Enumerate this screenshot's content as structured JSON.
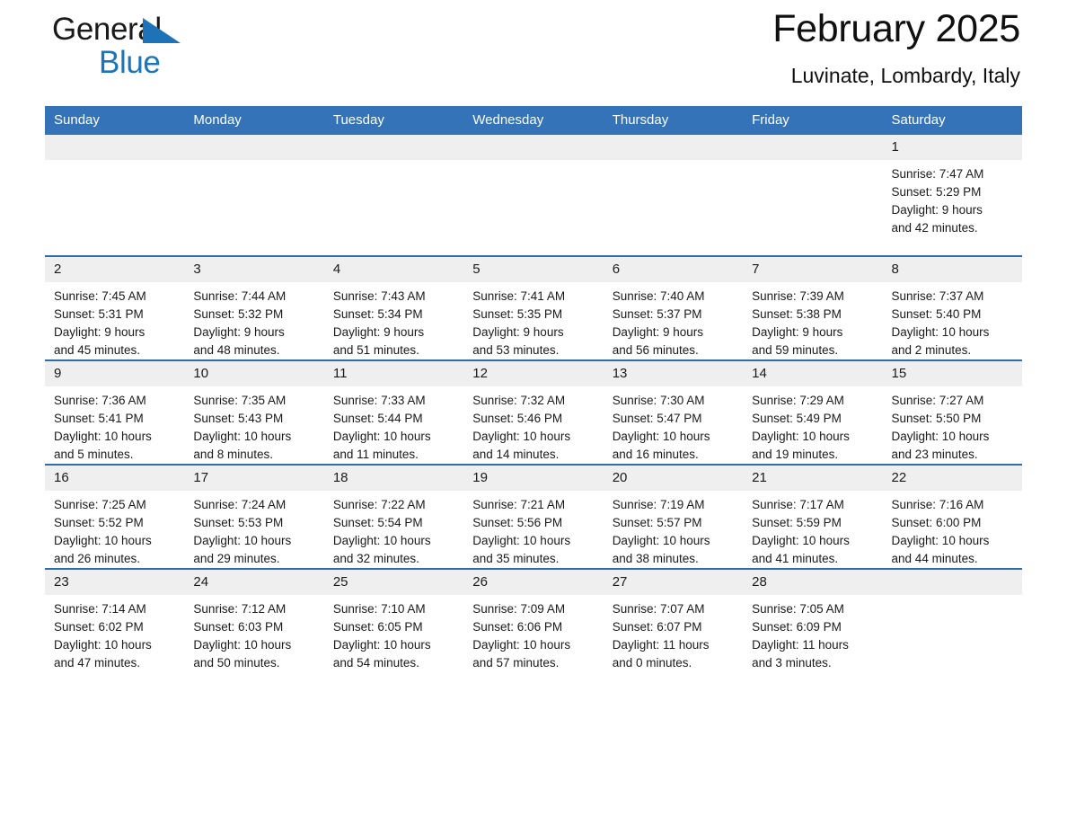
{
  "brand": {
    "word_one": "General",
    "word_two": "Blue",
    "triangle_color": "#1d72b8",
    "blue_text_color": "#1b75bb"
  },
  "header": {
    "month_title": "February 2025",
    "location": "Luvinate, Lombardy, Italy"
  },
  "theme": {
    "header_bg": "#3573b9",
    "row_divider": "#2e6da9",
    "daynum_bg": "#efefef",
    "text": "#1a1a1a"
  },
  "weekday_headers": [
    "Sunday",
    "Monday",
    "Tuesday",
    "Wednesday",
    "Thursday",
    "Friday",
    "Saturday"
  ],
  "labels": {
    "sunrise_prefix": "Sunrise:",
    "sunset_prefix": "Sunset:",
    "daylight_prefix": "Daylight:"
  },
  "weeks": [
    [
      {
        "day": "",
        "sunrise": "",
        "sunset": "",
        "daylight_line1": "",
        "daylight_line2": ""
      },
      {
        "day": "",
        "sunrise": "",
        "sunset": "",
        "daylight_line1": "",
        "daylight_line2": ""
      },
      {
        "day": "",
        "sunrise": "",
        "sunset": "",
        "daylight_line1": "",
        "daylight_line2": ""
      },
      {
        "day": "",
        "sunrise": "",
        "sunset": "",
        "daylight_line1": "",
        "daylight_line2": ""
      },
      {
        "day": "",
        "sunrise": "",
        "sunset": "",
        "daylight_line1": "",
        "daylight_line2": ""
      },
      {
        "day": "",
        "sunrise": "",
        "sunset": "",
        "daylight_line1": "",
        "daylight_line2": ""
      },
      {
        "day": "1",
        "sunrise": "Sunrise: 7:47 AM",
        "sunset": "Sunset: 5:29 PM",
        "daylight_line1": "Daylight: 9 hours",
        "daylight_line2": "and 42 minutes."
      }
    ],
    [
      {
        "day": "2",
        "sunrise": "Sunrise: 7:45 AM",
        "sunset": "Sunset: 5:31 PM",
        "daylight_line1": "Daylight: 9 hours",
        "daylight_line2": "and 45 minutes."
      },
      {
        "day": "3",
        "sunrise": "Sunrise: 7:44 AM",
        "sunset": "Sunset: 5:32 PM",
        "daylight_line1": "Daylight: 9 hours",
        "daylight_line2": "and 48 minutes."
      },
      {
        "day": "4",
        "sunrise": "Sunrise: 7:43 AM",
        "sunset": "Sunset: 5:34 PM",
        "daylight_line1": "Daylight: 9 hours",
        "daylight_line2": "and 51 minutes."
      },
      {
        "day": "5",
        "sunrise": "Sunrise: 7:41 AM",
        "sunset": "Sunset: 5:35 PM",
        "daylight_line1": "Daylight: 9 hours",
        "daylight_line2": "and 53 minutes."
      },
      {
        "day": "6",
        "sunrise": "Sunrise: 7:40 AM",
        "sunset": "Sunset: 5:37 PM",
        "daylight_line1": "Daylight: 9 hours",
        "daylight_line2": "and 56 minutes."
      },
      {
        "day": "7",
        "sunrise": "Sunrise: 7:39 AM",
        "sunset": "Sunset: 5:38 PM",
        "daylight_line1": "Daylight: 9 hours",
        "daylight_line2": "and 59 minutes."
      },
      {
        "day": "8",
        "sunrise": "Sunrise: 7:37 AM",
        "sunset": "Sunset: 5:40 PM",
        "daylight_line1": "Daylight: 10 hours",
        "daylight_line2": "and 2 minutes."
      }
    ],
    [
      {
        "day": "9",
        "sunrise": "Sunrise: 7:36 AM",
        "sunset": "Sunset: 5:41 PM",
        "daylight_line1": "Daylight: 10 hours",
        "daylight_line2": "and 5 minutes."
      },
      {
        "day": "10",
        "sunrise": "Sunrise: 7:35 AM",
        "sunset": "Sunset: 5:43 PM",
        "daylight_line1": "Daylight: 10 hours",
        "daylight_line2": "and 8 minutes."
      },
      {
        "day": "11",
        "sunrise": "Sunrise: 7:33 AM",
        "sunset": "Sunset: 5:44 PM",
        "daylight_line1": "Daylight: 10 hours",
        "daylight_line2": "and 11 minutes."
      },
      {
        "day": "12",
        "sunrise": "Sunrise: 7:32 AM",
        "sunset": "Sunset: 5:46 PM",
        "daylight_line1": "Daylight: 10 hours",
        "daylight_line2": "and 14 minutes."
      },
      {
        "day": "13",
        "sunrise": "Sunrise: 7:30 AM",
        "sunset": "Sunset: 5:47 PM",
        "daylight_line1": "Daylight: 10 hours",
        "daylight_line2": "and 16 minutes."
      },
      {
        "day": "14",
        "sunrise": "Sunrise: 7:29 AM",
        "sunset": "Sunset: 5:49 PM",
        "daylight_line1": "Daylight: 10 hours",
        "daylight_line2": "and 19 minutes."
      },
      {
        "day": "15",
        "sunrise": "Sunrise: 7:27 AM",
        "sunset": "Sunset: 5:50 PM",
        "daylight_line1": "Daylight: 10 hours",
        "daylight_line2": "and 23 minutes."
      }
    ],
    [
      {
        "day": "16",
        "sunrise": "Sunrise: 7:25 AM",
        "sunset": "Sunset: 5:52 PM",
        "daylight_line1": "Daylight: 10 hours",
        "daylight_line2": "and 26 minutes."
      },
      {
        "day": "17",
        "sunrise": "Sunrise: 7:24 AM",
        "sunset": "Sunset: 5:53 PM",
        "daylight_line1": "Daylight: 10 hours",
        "daylight_line2": "and 29 minutes."
      },
      {
        "day": "18",
        "sunrise": "Sunrise: 7:22 AM",
        "sunset": "Sunset: 5:54 PM",
        "daylight_line1": "Daylight: 10 hours",
        "daylight_line2": "and 32 minutes."
      },
      {
        "day": "19",
        "sunrise": "Sunrise: 7:21 AM",
        "sunset": "Sunset: 5:56 PM",
        "daylight_line1": "Daylight: 10 hours",
        "daylight_line2": "and 35 minutes."
      },
      {
        "day": "20",
        "sunrise": "Sunrise: 7:19 AM",
        "sunset": "Sunset: 5:57 PM",
        "daylight_line1": "Daylight: 10 hours",
        "daylight_line2": "and 38 minutes."
      },
      {
        "day": "21",
        "sunrise": "Sunrise: 7:17 AM",
        "sunset": "Sunset: 5:59 PM",
        "daylight_line1": "Daylight: 10 hours",
        "daylight_line2": "and 41 minutes."
      },
      {
        "day": "22",
        "sunrise": "Sunrise: 7:16 AM",
        "sunset": "Sunset: 6:00 PM",
        "daylight_line1": "Daylight: 10 hours",
        "daylight_line2": "and 44 minutes."
      }
    ],
    [
      {
        "day": "23",
        "sunrise": "Sunrise: 7:14 AM",
        "sunset": "Sunset: 6:02 PM",
        "daylight_line1": "Daylight: 10 hours",
        "daylight_line2": "and 47 minutes."
      },
      {
        "day": "24",
        "sunrise": "Sunrise: 7:12 AM",
        "sunset": "Sunset: 6:03 PM",
        "daylight_line1": "Daylight: 10 hours",
        "daylight_line2": "and 50 minutes."
      },
      {
        "day": "25",
        "sunrise": "Sunrise: 7:10 AM",
        "sunset": "Sunset: 6:05 PM",
        "daylight_line1": "Daylight: 10 hours",
        "daylight_line2": "and 54 minutes."
      },
      {
        "day": "26",
        "sunrise": "Sunrise: 7:09 AM",
        "sunset": "Sunset: 6:06 PM",
        "daylight_line1": "Daylight: 10 hours",
        "daylight_line2": "and 57 minutes."
      },
      {
        "day": "27",
        "sunrise": "Sunrise: 7:07 AM",
        "sunset": "Sunset: 6:07 PM",
        "daylight_line1": "Daylight: 11 hours",
        "daylight_line2": "and 0 minutes."
      },
      {
        "day": "28",
        "sunrise": "Sunrise: 7:05 AM",
        "sunset": "Sunset: 6:09 PM",
        "daylight_line1": "Daylight: 11 hours",
        "daylight_line2": "and 3 minutes."
      },
      {
        "day": "",
        "sunrise": "",
        "sunset": "",
        "daylight_line1": "",
        "daylight_line2": ""
      }
    ]
  ]
}
